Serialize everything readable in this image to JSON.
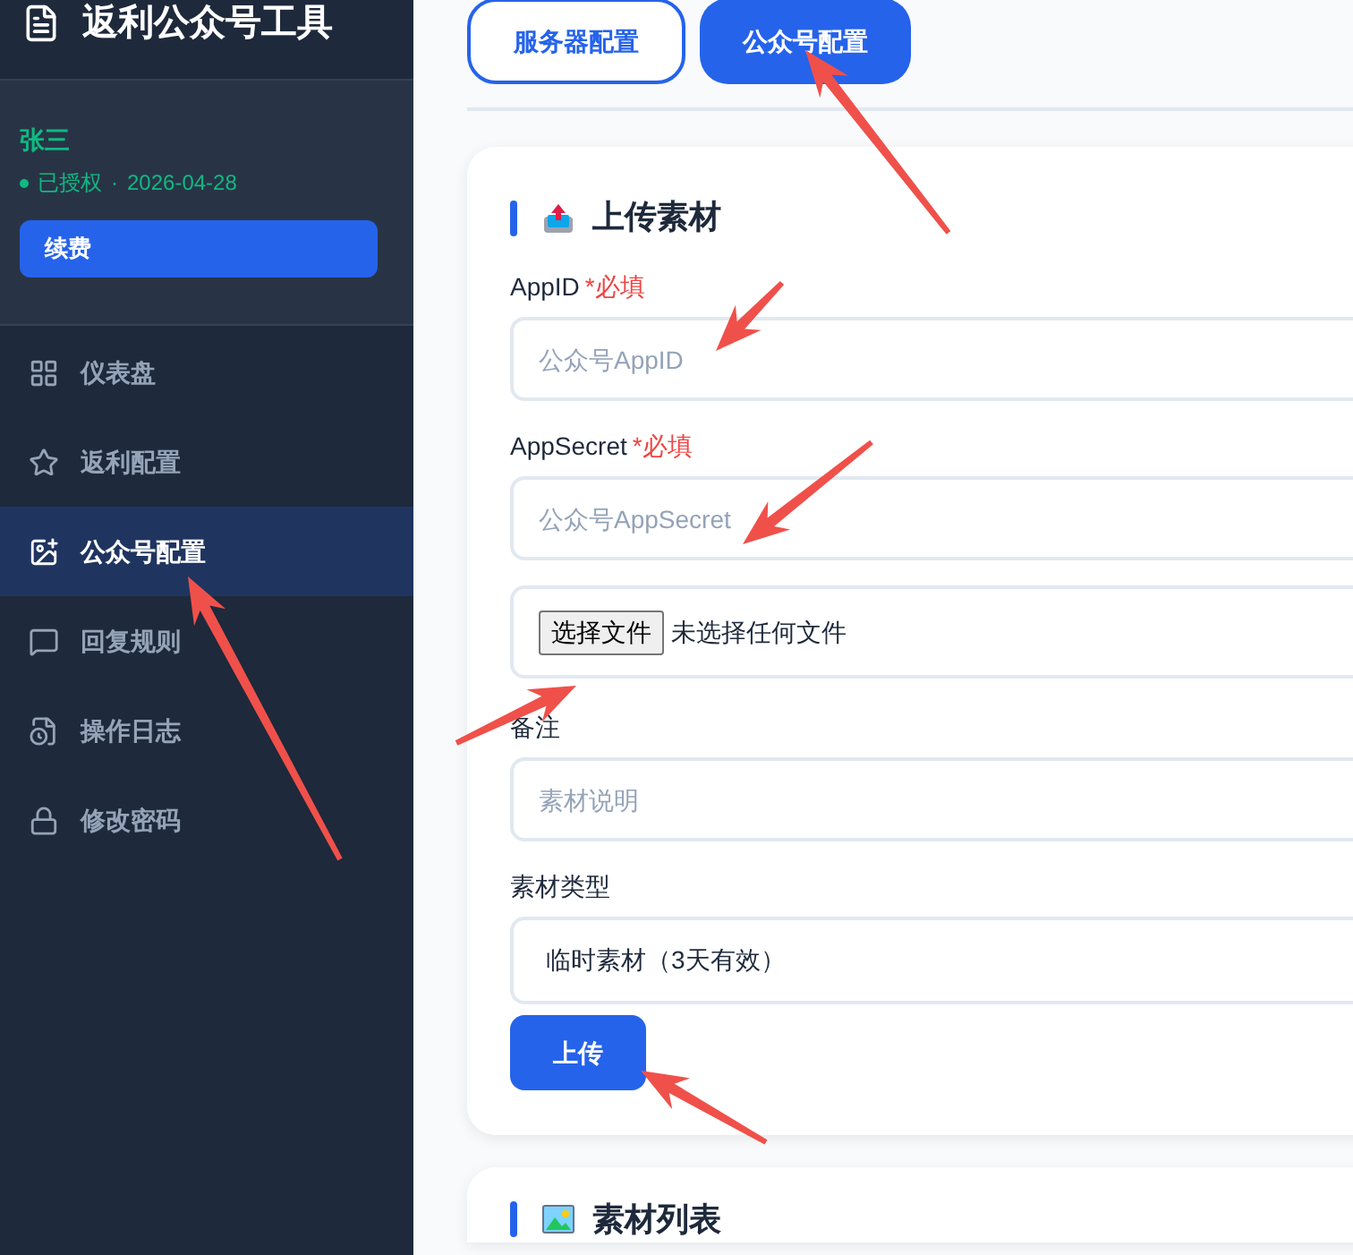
{
  "sidebar": {
    "title": "返利公众号工具",
    "user": {
      "name": "张三",
      "status": "已授权",
      "separator": "·",
      "date": "2026-04-28",
      "renew_button": "续费"
    },
    "items": [
      {
        "label": "仪表盘",
        "kind": "grid",
        "selected": false
      },
      {
        "label": "返利配置",
        "kind": "star",
        "selected": false
      },
      {
        "label": "公众号配置",
        "kind": "image",
        "selected": true
      },
      {
        "label": "回复规则",
        "kind": "message",
        "selected": false
      },
      {
        "label": "操作日志",
        "kind": "log",
        "selected": false
      },
      {
        "label": "修改密码",
        "kind": "lock",
        "selected": false
      }
    ]
  },
  "tabs": [
    {
      "label": "服务器配置",
      "selected": false
    },
    {
      "label": "公众号配置",
      "selected": true
    }
  ],
  "upload_card": {
    "title": "上传素材",
    "fields": [
      {
        "kind": "text",
        "label": "AppID",
        "required": "*必填",
        "placeholder": "公众号AppID"
      },
      {
        "kind": "text",
        "label": "AppSecret",
        "required": "*必填",
        "placeholder": "公众号AppSecret"
      },
      {
        "kind": "file",
        "button": "选择文件",
        "status": "未选择任何文件"
      },
      {
        "kind": "text",
        "label": "备注",
        "placeholder": "素材说明"
      },
      {
        "kind": "select",
        "label": "素材类型",
        "value": "临时素材（3天有效）"
      }
    ],
    "submit_button": "上传"
  },
  "list_card": {
    "title": "素材列表"
  }
}
